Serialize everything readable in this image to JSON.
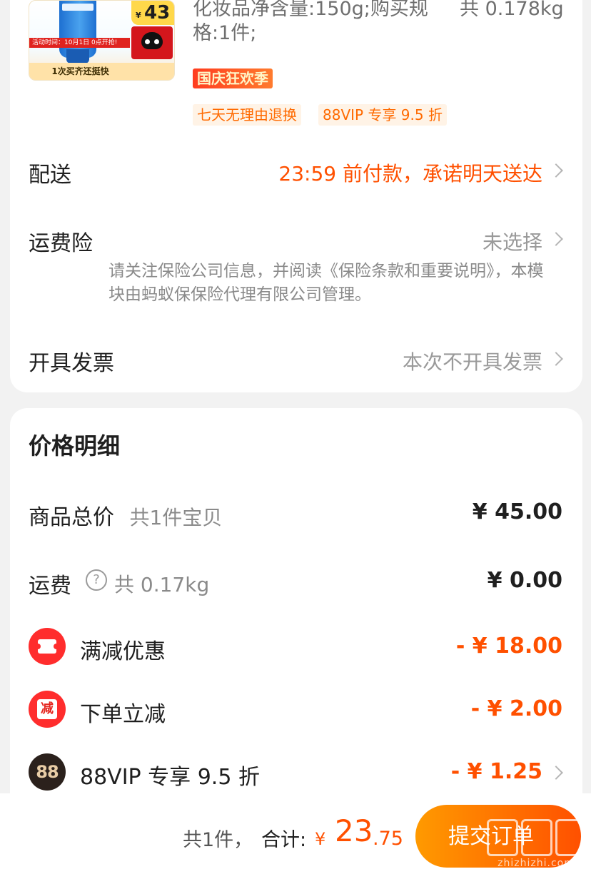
{
  "product": {
    "price_tag_currency": "¥",
    "price_tag_value": "43",
    "activity_banner": "活动时间：10月1日 0点开抢!",
    "rebuy_text": "1次买齐还挺快",
    "spec_text": "化妆品净含量:150g;购买规格:1件;",
    "weight_text": "共 0.178kg",
    "promo_tag": "国庆狂欢季",
    "service_tags": [
      "七天无理由退换",
      "88VIP 专享 9.5 折"
    ]
  },
  "delivery": {
    "label": "配送",
    "value": "23:59 前付款，承诺明天送达",
    "value_color": "#ff5000"
  },
  "shipping_insurance": {
    "label": "运费险",
    "value": "未选择",
    "note": "请关注保险公司信息，并阅读《保险条款和重要说明》，本模块由蚂蚁保保险代理有限公司管理。"
  },
  "invoice": {
    "label": "开具发票",
    "value": "本次不开具发票"
  },
  "price_detail": {
    "title": "价格明细",
    "goods_total": {
      "label": "商品总价",
      "sub": "共1件宝贝",
      "amount": "¥ 45.00"
    },
    "shipping": {
      "label": "运费",
      "icon": "help-icon",
      "sub": "共 0.17kg",
      "amount": "¥ 0.00"
    },
    "discounts": [
      {
        "label": "满减优惠",
        "amount": "- ¥ 18.00",
        "icon": "coupon-icon"
      },
      {
        "label": "下单立减",
        "amount": "- ¥ 2.00",
        "icon": "instant-reduce-icon",
        "icon_text": "减"
      },
      {
        "label": "88VIP 专享 9.5 折",
        "amount": "- ¥ 1.25",
        "icon": "vip88-icon",
        "icon_text": "88"
      }
    ]
  },
  "footer": {
    "count_text": "共1件，",
    "total_label": "合计:",
    "currency": "¥",
    "total_int": "23",
    "total_dec": ".75",
    "submit_label": "提交订单",
    "watermark_text": "zhizhizhi.com"
  },
  "colors": {
    "accent": "#ff5000",
    "background": "#f2f2f2",
    "card": "#ffffff"
  }
}
